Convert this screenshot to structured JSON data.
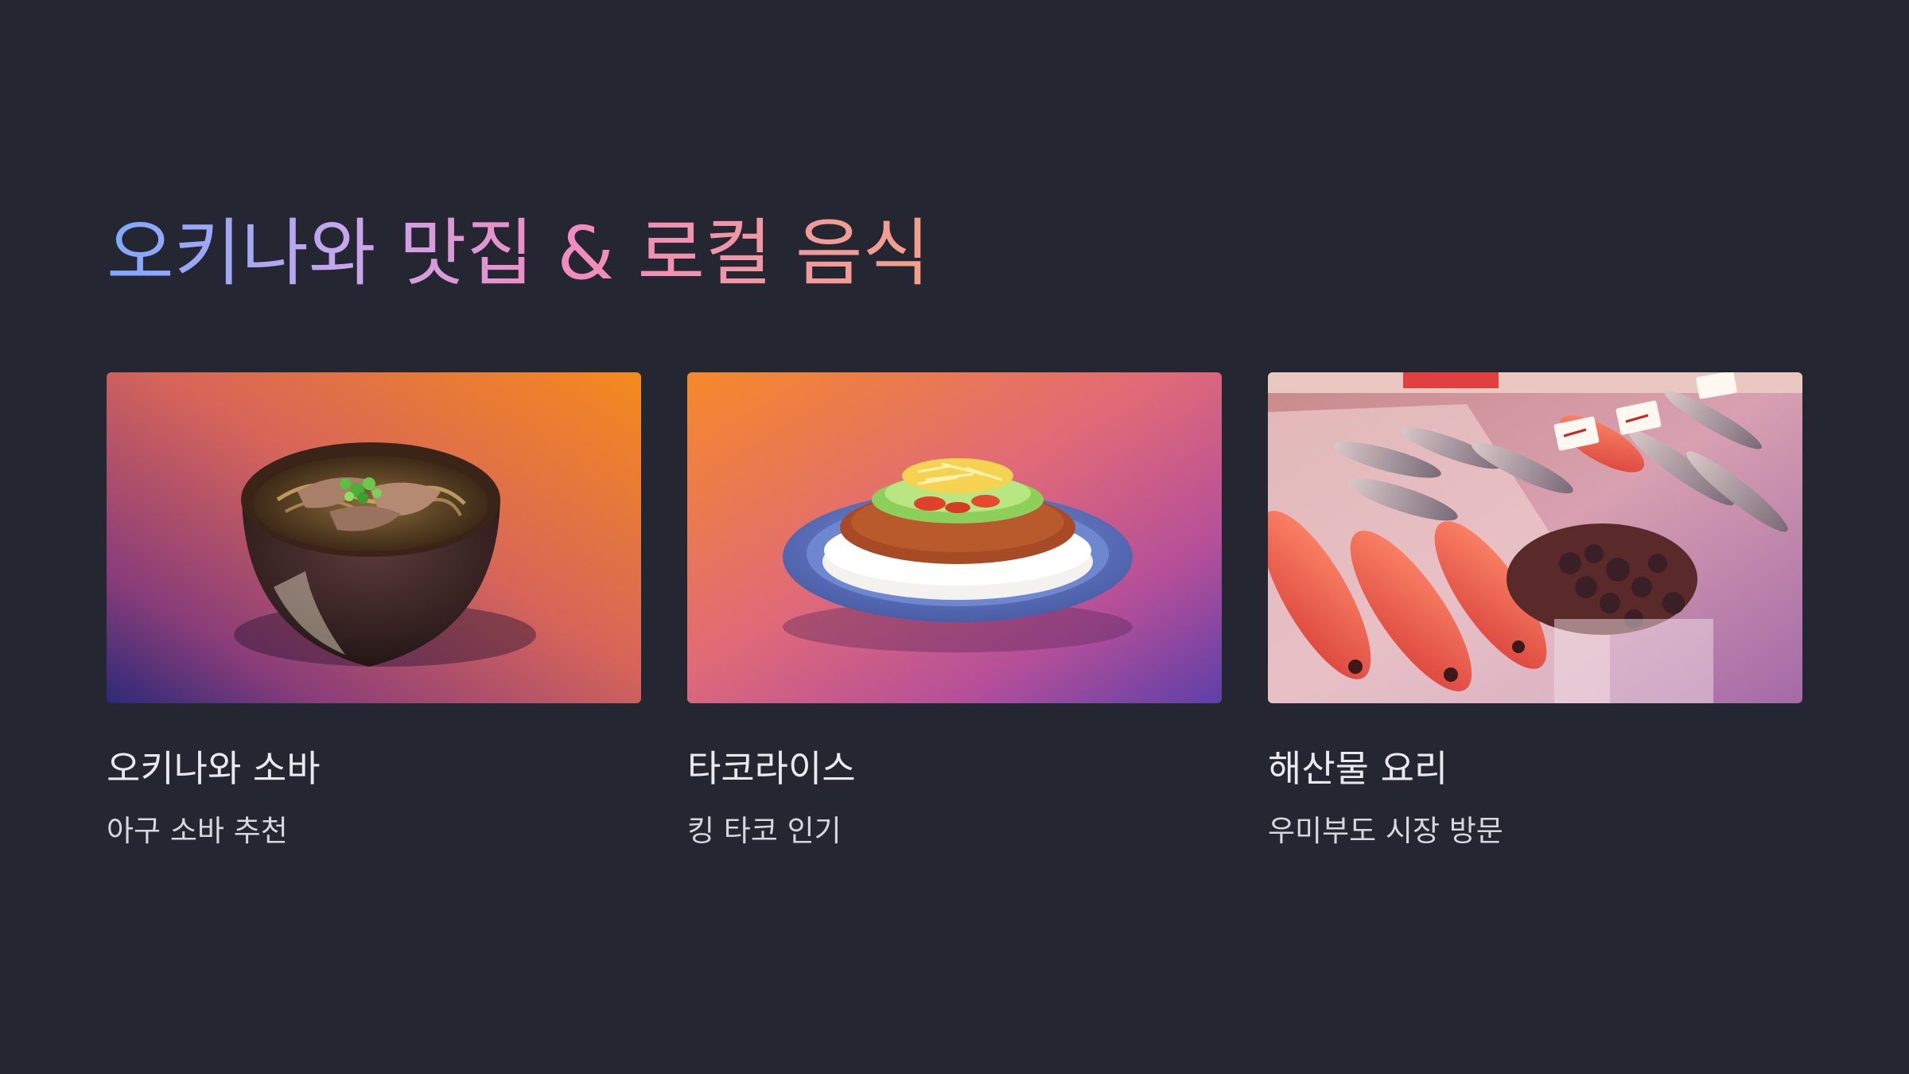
{
  "slide": {
    "title": "오키나와 맛집 & 로컬 음식",
    "background_color": "#242632",
    "title_gradient": [
      "#7fa8ff",
      "#c9a6ec",
      "#f08bc0",
      "#f2a189"
    ]
  },
  "cards": [
    {
      "title": "오키나와 소바",
      "subtitle": "아구 소바 추천",
      "image": "okinawa-soba-bowl-photo"
    },
    {
      "title": "타코라이스",
      "subtitle": "킹 타코 인기",
      "image": "taco-rice-plate-photo"
    },
    {
      "title": "해산물 요리",
      "subtitle": "우미부도 시장 방문",
      "image": "fish-market-seafood-photo"
    }
  ]
}
